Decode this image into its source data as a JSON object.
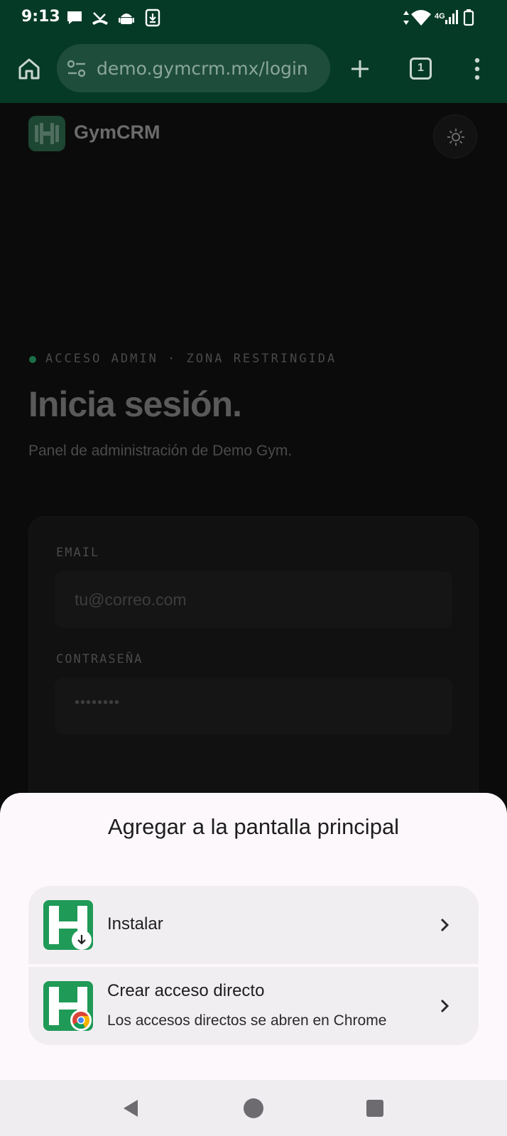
{
  "status": {
    "time": "9:13",
    "network": "4G"
  },
  "browser": {
    "url": "demo.gymcrm.mx/login",
    "tab_count": "1"
  },
  "page": {
    "brand": "GymCRM",
    "eyebrow": "ACCESO ADMIN · ZONA RESTRINGIDA",
    "heading": "Inicia sesión.",
    "subtitle": "Panel de administración de Demo Gym.",
    "email_label": "EMAIL",
    "email_placeholder": "tu@correo.com",
    "password_label": "CONTRASEÑA",
    "password_placeholder": "••••••••"
  },
  "sheet": {
    "title": "Agregar a la pantalla principal",
    "options": [
      {
        "title": "Instalar",
        "subtitle": ""
      },
      {
        "title": "Crear acceso directo",
        "subtitle": "Los accesos directos se abren en Chrome"
      }
    ]
  },
  "colors": {
    "chrome_green": "#053a27",
    "app_icon_green": "#1f9a57",
    "sheet_bg": "#fdf8fc"
  },
  "icons": {
    "status": [
      "message-icon",
      "missed-call-icon",
      "android-icon",
      "download-notification-icon",
      "data-arrows-icon",
      "wifi-icon",
      "signal-icon",
      "battery-icon"
    ],
    "toolbar": [
      "home-icon",
      "site-settings-icon",
      "new-tab-icon",
      "tab-switcher-icon",
      "more-menu-icon"
    ],
    "nav": [
      "back-icon",
      "home-nav-icon",
      "recents-icon"
    ]
  }
}
